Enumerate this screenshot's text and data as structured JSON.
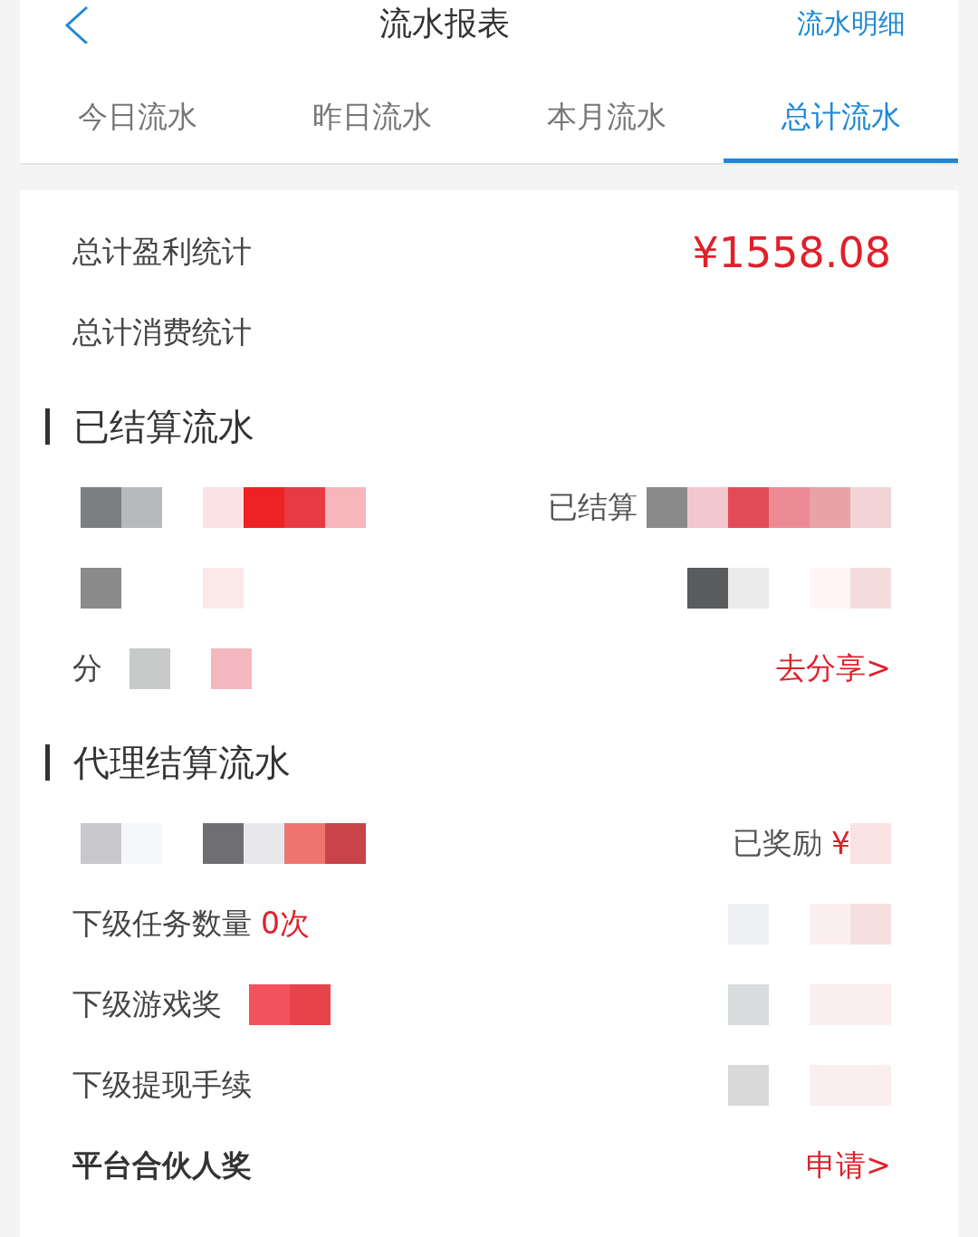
{
  "header": {
    "title": "流水报表",
    "action": "流水明细"
  },
  "tabs": [
    {
      "label": "今日流水",
      "selected": false
    },
    {
      "label": "昨日流水",
      "selected": false
    },
    {
      "label": "本月流水",
      "selected": false
    },
    {
      "label": "总计流水",
      "selected": true
    }
  ],
  "summary": [
    {
      "label": "总计盈利统计",
      "value": "¥1558.08"
    },
    {
      "label": "总计消费统计"
    }
  ],
  "sections": [
    {
      "title": "已结算流水",
      "rows": [
        {
          "left_redacted": true,
          "right_text": "已结算",
          "right_redacted": true
        },
        {
          "left_redacted": true,
          "right_redacted": true
        },
        {
          "label": "分",
          "left_redacted": true,
          "link": "去分享>"
        }
      ]
    },
    {
      "title": "代理结算流水",
      "rows": [
        {
          "left_redacted": true,
          "right_text": "已奖励",
          "right_value": "¥",
          "right_redacted": true
        },
        {
          "label": "下级任务数量",
          "value": "0次",
          "right_redacted": true
        },
        {
          "label": "下级游戏奖",
          "left_redacted": true,
          "right_redacted": true
        },
        {
          "label": "下级提现手续",
          "right_redacted": true
        },
        {
          "label": "平台合伙人奖",
          "bold": true,
          "link": "申请>"
        }
      ]
    }
  ]
}
